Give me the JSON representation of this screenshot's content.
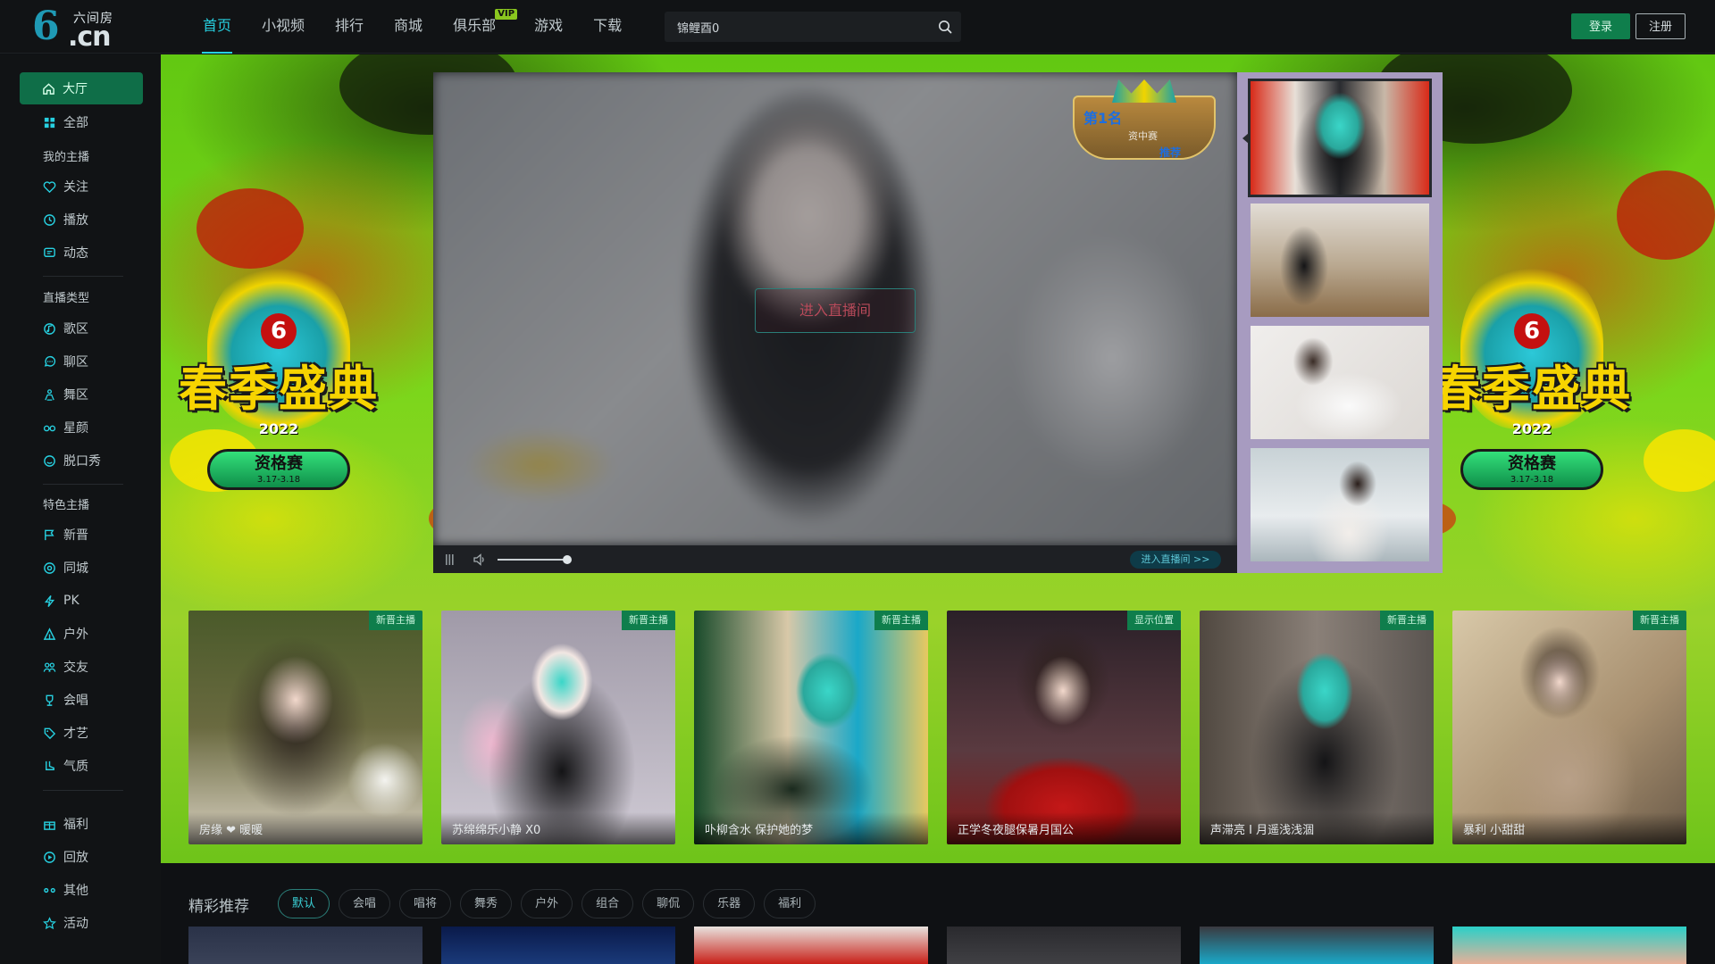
{
  "logo": {
    "mark": "6",
    "top": "六间房",
    "bottom": ".cn"
  },
  "nav": {
    "items": [
      "首页",
      "小视频",
      "排行",
      "商城",
      "俱乐部",
      "游戏",
      "下载"
    ],
    "vip_badge": "VIP"
  },
  "search": {
    "value": "锦鲤酉0",
    "placeholder": ""
  },
  "auth": {
    "login": "登录",
    "register": "注册"
  },
  "sidebar": {
    "main": "大厅",
    "all": "全部",
    "my_anchors_head": "我的主播",
    "my_anchors": [
      "关注",
      "播放",
      "动态"
    ],
    "live_types_head": "直播类型",
    "live_types": [
      "歌区",
      "聊区",
      "舞区",
      "星颜",
      "脱口秀"
    ],
    "featured_head": "特色主播",
    "featured": [
      "新晋",
      "同城",
      "PK",
      "户外",
      "交友",
      "会唱",
      "才艺",
      "气质"
    ],
    "extra": [
      "福利",
      "回放",
      "其他",
      "活动"
    ]
  },
  "banner": {
    "emblem_title": "春季盛典",
    "emblem_year": "2022",
    "emblem_pill": "资格赛",
    "emblem_pill_date": "3.17-3.18"
  },
  "player": {
    "enter_button": "进入直播间",
    "controls_enter": "进入直播间 >>",
    "rank_badge": {
      "title": "第1名",
      "subtitle": "资中赛",
      "label": "推荐"
    }
  },
  "cards": [
    {
      "name": "房缘 ❤ 暖暖",
      "tag": "新晋主播"
    },
    {
      "name": "苏绵绵乐小静 X0",
      "tag": "新晋主播"
    },
    {
      "name": "卟柳含水 保护她的梦",
      "tag": "新晋主播"
    },
    {
      "name": "正学冬夜腿保暑月国公",
      "tag": "显示位置"
    },
    {
      "name": "声滞亮 I 月遥浅浅涸",
      "tag": "新晋主播"
    },
    {
      "name": "暴利 小甜甜",
      "tag": "新晋主播"
    }
  ],
  "recommend": {
    "title": "精彩推荐",
    "filters": [
      "默认",
      "会唱",
      "唱将",
      "舞秀",
      "户外",
      "组合",
      "聊侃",
      "乐器",
      "福利"
    ]
  },
  "colors": {
    "accent": "#27d0e0",
    "green": "#0f7e4c",
    "banner_green": "#7ad61a"
  }
}
